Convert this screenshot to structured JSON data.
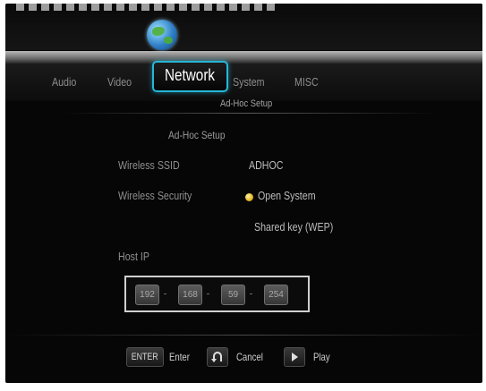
{
  "menu": {
    "tabs": [
      {
        "label": "Audio"
      },
      {
        "label": "Video"
      },
      {
        "label": "Network"
      },
      {
        "label": "System"
      },
      {
        "label": "MISC"
      }
    ],
    "active_tab": "Network",
    "subtitle": "Ad-Hoc Setup"
  },
  "panel": {
    "title": "Ad-Hoc Setup",
    "ssid_label": "Wireless SSID",
    "ssid_value": "ADHOC",
    "security_label": "Wireless Security",
    "security_options": [
      "Open System",
      "Shared key (WEP)"
    ],
    "security_selected": "Open System",
    "host_ip_label": "Host IP",
    "host_ip": [
      "192",
      "168",
      "59",
      "254"
    ]
  },
  "footer": {
    "enter_key": "ENTER",
    "enter_label": "Enter",
    "cancel_label": "Cancel",
    "play_label": "Play"
  },
  "colors": {
    "accent": "#27b6d6",
    "radio": "#e6b620",
    "background": "#060606"
  },
  "icons": {
    "network_tab": "globe-icon",
    "cancel": "return-icon",
    "play": "play-icon"
  }
}
